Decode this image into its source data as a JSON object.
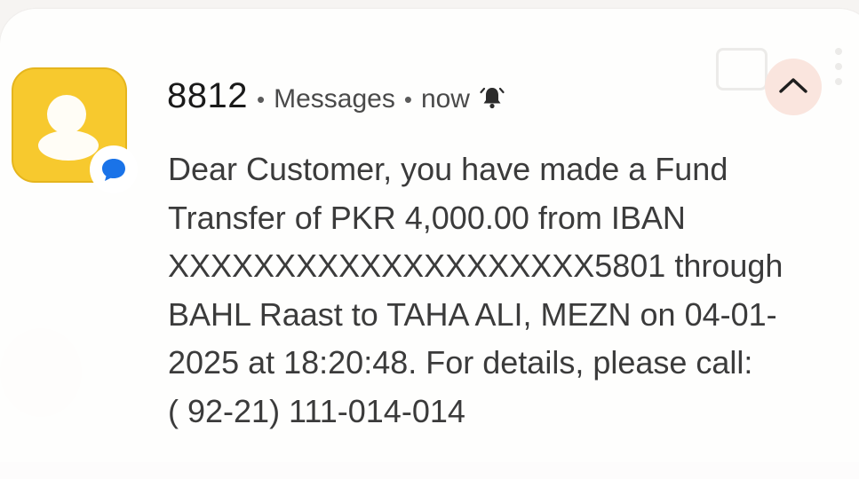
{
  "notification": {
    "sender": "8812",
    "separator": "•",
    "app_name": "Messages",
    "time": "now",
    "bell_icon": "bell-ring-icon",
    "avatar_icon": "person-avatar-icon",
    "badge_icon": "messages-chat-icon",
    "collapse_icon": "chevron-up-icon",
    "message_lines": [
      "Dear Customer, you have made a Fund",
      "Transfer of PKR 4,000.00 from IBAN",
      "XXXXXXXXXXXXXXXXXXXX5801 through",
      "BAHL Raast to TAHA ALI, MEZN on 04-01-",
      "2025 at 18:20:48. For details, please call:",
      "( 92-21) 111-014-014"
    ]
  },
  "colors": {
    "avatar_bg": "#f7c92e",
    "badge_blue": "#1a73e8",
    "collapse_bg": "#fae5de",
    "text_primary": "#1a1a1a",
    "text_body": "#3b3b3b"
  }
}
